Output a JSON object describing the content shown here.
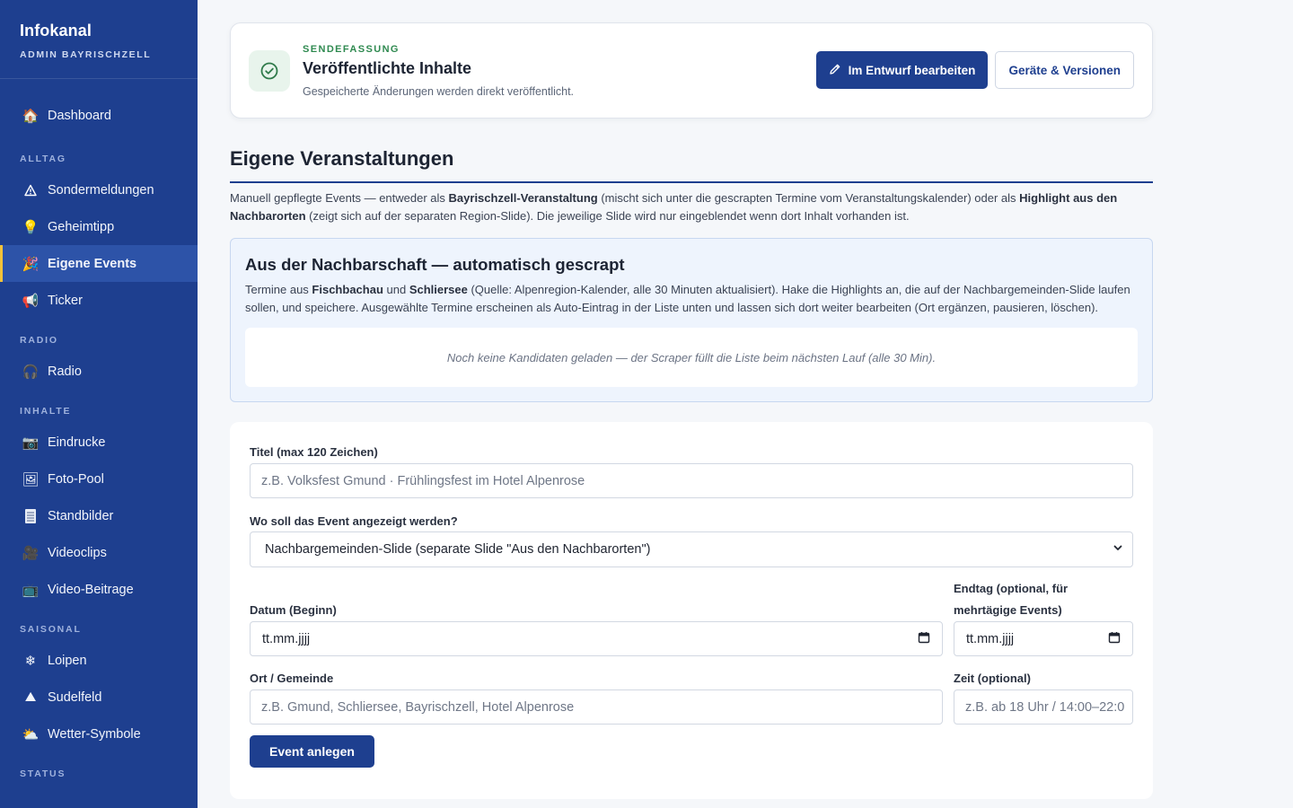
{
  "app": {
    "title": "Infokanal",
    "subtitle": "ADMIN BAYRISCHZELL"
  },
  "sidebar": {
    "top": [
      {
        "label": "Dashboard",
        "icon": "house-icon"
      }
    ],
    "sections": [
      {
        "title": "ALLTAG",
        "items": [
          {
            "label": "Sondermeldungen",
            "icon": "warning-icon"
          },
          {
            "label": "Geheimtipp",
            "icon": "lightbulb-icon"
          },
          {
            "label": "Eigene Events",
            "icon": "party-popper-icon",
            "active": true
          },
          {
            "label": "Ticker",
            "icon": "megaphone-icon"
          }
        ]
      },
      {
        "title": "RADIO",
        "items": [
          {
            "label": "Radio",
            "icon": "headphones-icon"
          }
        ]
      },
      {
        "title": "INHALTE",
        "items": [
          {
            "label": "Eindrucke",
            "icon": "camera-icon"
          },
          {
            "label": "Foto-Pool",
            "icon": "picture-icon"
          },
          {
            "label": "Standbilder",
            "icon": "document-icon"
          },
          {
            "label": "Videoclips",
            "icon": "film-icon"
          },
          {
            "label": "Video-Beitrage",
            "icon": "tv-icon"
          }
        ]
      },
      {
        "title": "SAISONAL",
        "items": [
          {
            "label": "Loipen",
            "icon": "snowflake-icon"
          },
          {
            "label": "Sudelfeld",
            "icon": "mountain-icon"
          },
          {
            "label": "Wetter-Symbole",
            "icon": "cloud-sun-icon"
          }
        ]
      },
      {
        "title": "STATUS",
        "items": []
      }
    ]
  },
  "status": {
    "eyebrow": "SENDEFASSUNG",
    "title": "Veröffentlichte Inhalte",
    "desc": "Gespeicherte Änderungen werden direkt veröffentlicht.",
    "edit_label": "Im Entwurf bearbeiten",
    "devices_label": "Geräte & Versionen"
  },
  "events": {
    "title": "Eigene Veranstaltungen",
    "desc_1": "Manuell gepflegte Events — entweder als ",
    "desc_b1": "Bayrischzell-Veranstaltung",
    "desc_2": " (mischt sich unter die gescrapten Termine vom Veranstaltungskalender) oder als ",
    "desc_b2": "Highlight aus den Nachbarorten",
    "desc_3": " (zeigt sich auf der separaten Region-Slide). Die jeweilige Slide wird nur eingeblendet wenn dort Inhalt vorhanden ist."
  },
  "scrape": {
    "title": "Aus der Nachbarschaft — automatisch gescrapt",
    "desc_1": "Termine aus ",
    "desc_b1": "Fischbachau",
    "desc_2": " und ",
    "desc_b2": "Schliersee",
    "desc_3": " (Quelle: Alpenregion-Kalender, alle 30 Minuten aktualisiert). Hake die Highlights an, die auf der Nachbargemeinden-Slide laufen sollen, und speichere. Ausgewählte Termine erscheinen als Auto-Eintrag in der Liste unten und lassen sich dort weiter bearbeiten (Ort ergänzen, pausieren, löschen).",
    "empty": "Noch keine Kandidaten geladen — der Scraper füllt die Liste beim nächsten Lauf (alle 30 Min)."
  },
  "form": {
    "title_label": "Titel (max 120 Zeichen)",
    "title_placeholder": "z.B. Volksfest Gmund · Frühlingsfest im Hotel Alpenrose",
    "where_label": "Wo soll das Event angezeigt werden?",
    "where_value": "Nachbargemeinden-Slide (separate Slide \"Aus den Nachbarorten\")",
    "date_label": "Datum (Beginn)",
    "date_placeholder": "tt.mm.jjjj",
    "enddate_label": "Endtag (optional, für mehrtägige Events)",
    "enddate_placeholder": "tt.mm.jjjj",
    "place_label": "Ort / Gemeinde",
    "place_placeholder": "z.B. Gmund, Schliersee, Bayrischzell, Hotel Alpenrose",
    "time_label": "Zeit (optional)",
    "time_placeholder": "z.B. ab 18 Uhr / 14:00–22:0",
    "submit_label": "Event anlegen"
  },
  "colors": {
    "sidebar": "#1e3f8f",
    "active_item": "#2d53a8",
    "accent_bar": "#f3c23a",
    "success": "#2f8a50"
  }
}
